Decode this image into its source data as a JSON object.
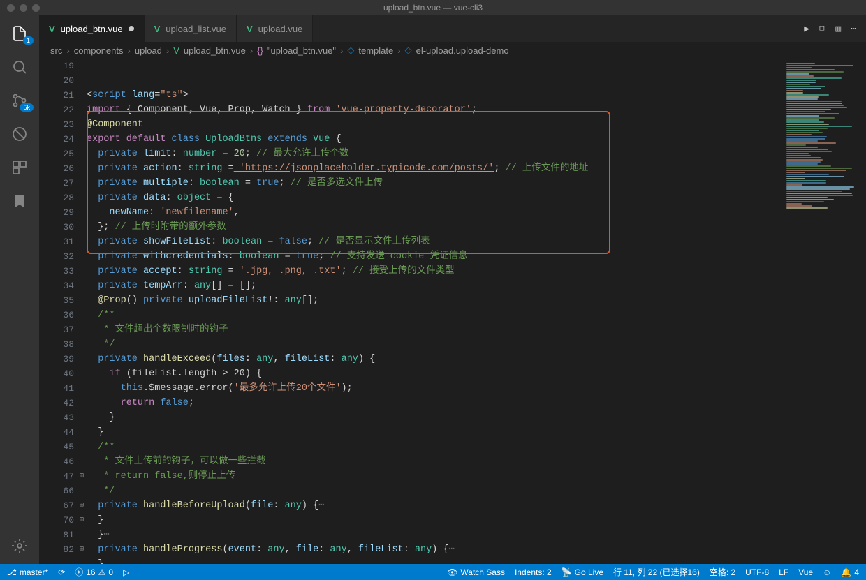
{
  "titlebar": {
    "title": "upload_btn.vue — vue-cli3"
  },
  "activity": {
    "explorer_badge": "1",
    "scm_badge": "5k"
  },
  "tabs": [
    {
      "label": "upload_btn.vue",
      "active": true,
      "dirty": true
    },
    {
      "label": "upload_list.vue",
      "active": false,
      "dirty": false
    },
    {
      "label": "upload.vue",
      "active": false,
      "dirty": false
    }
  ],
  "breadcrumbs": {
    "path": [
      "src",
      "components",
      "upload"
    ],
    "file": "upload_btn.vue",
    "symbol1": "\"upload_btn.vue\"",
    "symbol2": "template",
    "symbol3": "el-upload.upload-demo"
  },
  "code_lines": [
    19,
    20,
    21,
    22,
    23,
    24,
    25,
    26,
    27,
    28,
    29,
    30,
    31,
    32,
    33,
    34,
    35,
    36,
    37,
    38,
    39,
    40,
    41,
    42,
    43,
    44,
    45,
    46,
    47,
    66,
    67,
    70,
    81,
    82
  ],
  "code": {
    "l19": "<script lang=\"ts\">",
    "l20_import": "import",
    "l20_braces": " { Component, Vue, Prop, Watch } ",
    "l20_from": "from",
    "l20_str": " 'vue-property-decorator'",
    "l21": "@Component",
    "l22_export": "export",
    "l22_default": " default ",
    "l22_class": "class ",
    "l22_name": "UploadBtns ",
    "l22_extends": "extends ",
    "l22_vue": "Vue",
    "l23_priv": "private",
    "l23_name": " limit",
    "l23_type": " number",
    "l23_val": " 20",
    "l23_cmnt": " // 最大允许上传个数",
    "l24_name": " action",
    "l24_type": " string",
    "l24_val": " 'https://jsonplaceholder.typicode.com/posts/'",
    "l24_cmnt": " // 上传文件的地址",
    "l25_name": " multiple",
    "l25_type": " boolean",
    "l25_val": " true",
    "l25_cmnt": " // 是否多选文件上传",
    "l26_name": " data",
    "l26_type": " object",
    "l27_key": "newName",
    "l27_val": " 'newfilename'",
    "l28_cmnt": " // 上传时附带的额外参数",
    "l29_name": " showFileList",
    "l29_type": " boolean",
    "l29_val": " false",
    "l29_cmnt": " // 是否显示文件上传列表",
    "l30_name": " withcredentials",
    "l30_type": " boolean",
    "l30_val": " true",
    "l30_cmnt": " // 支持发送 cookie 凭证信息",
    "l31_name": " accept",
    "l31_type": " string",
    "l31_val": " '.jpg, .png, .txt'",
    "l31_cmnt": " // 接受上传的文件类型",
    "l32_name": " tempArr",
    "l32_type": " any",
    "l33_prop": "@Prop",
    "l33_name": " uploadFileList",
    "l33_type": " any",
    "l34": "/**",
    "l35": " * 文件超出个数限制时的钩子",
    "l36": " */",
    "l37_name": " handleExceed",
    "l37_p1": "files",
    "l37_p2": "fileList",
    "l38_if": "if",
    "l38_cond": " (fileList.length > 20) {",
    "l39_this": "this",
    "l39_call": ".$message.error(",
    "l39_str": "'最多允许上传20个文件'",
    "l40_ret": "return",
    "l40_val": " false",
    "l43": "/**",
    "l44": " * 文件上传前的钩子，可以做一些拦截",
    "l45": " * return false,则停止上传",
    "l46": " */",
    "l47_name": " handleBeforeUpload",
    "l47_p": "file",
    "l70_name": " handleProgress",
    "l70_p1": "event",
    "l70_p2": "file",
    "l70_p3": "fileList",
    "l82": "/***"
  },
  "statusbar": {
    "branch": "master*",
    "errors": "16",
    "warnings": "0",
    "watch": "Watch Sass",
    "indents": "Indents: 2",
    "golive": "Go Live",
    "pos": "行 11, 列 22 (已选择16)",
    "spaces": "空格: 2",
    "encoding": "UTF-8",
    "eol": "LF",
    "lang": "Vue",
    "bell": "4"
  }
}
